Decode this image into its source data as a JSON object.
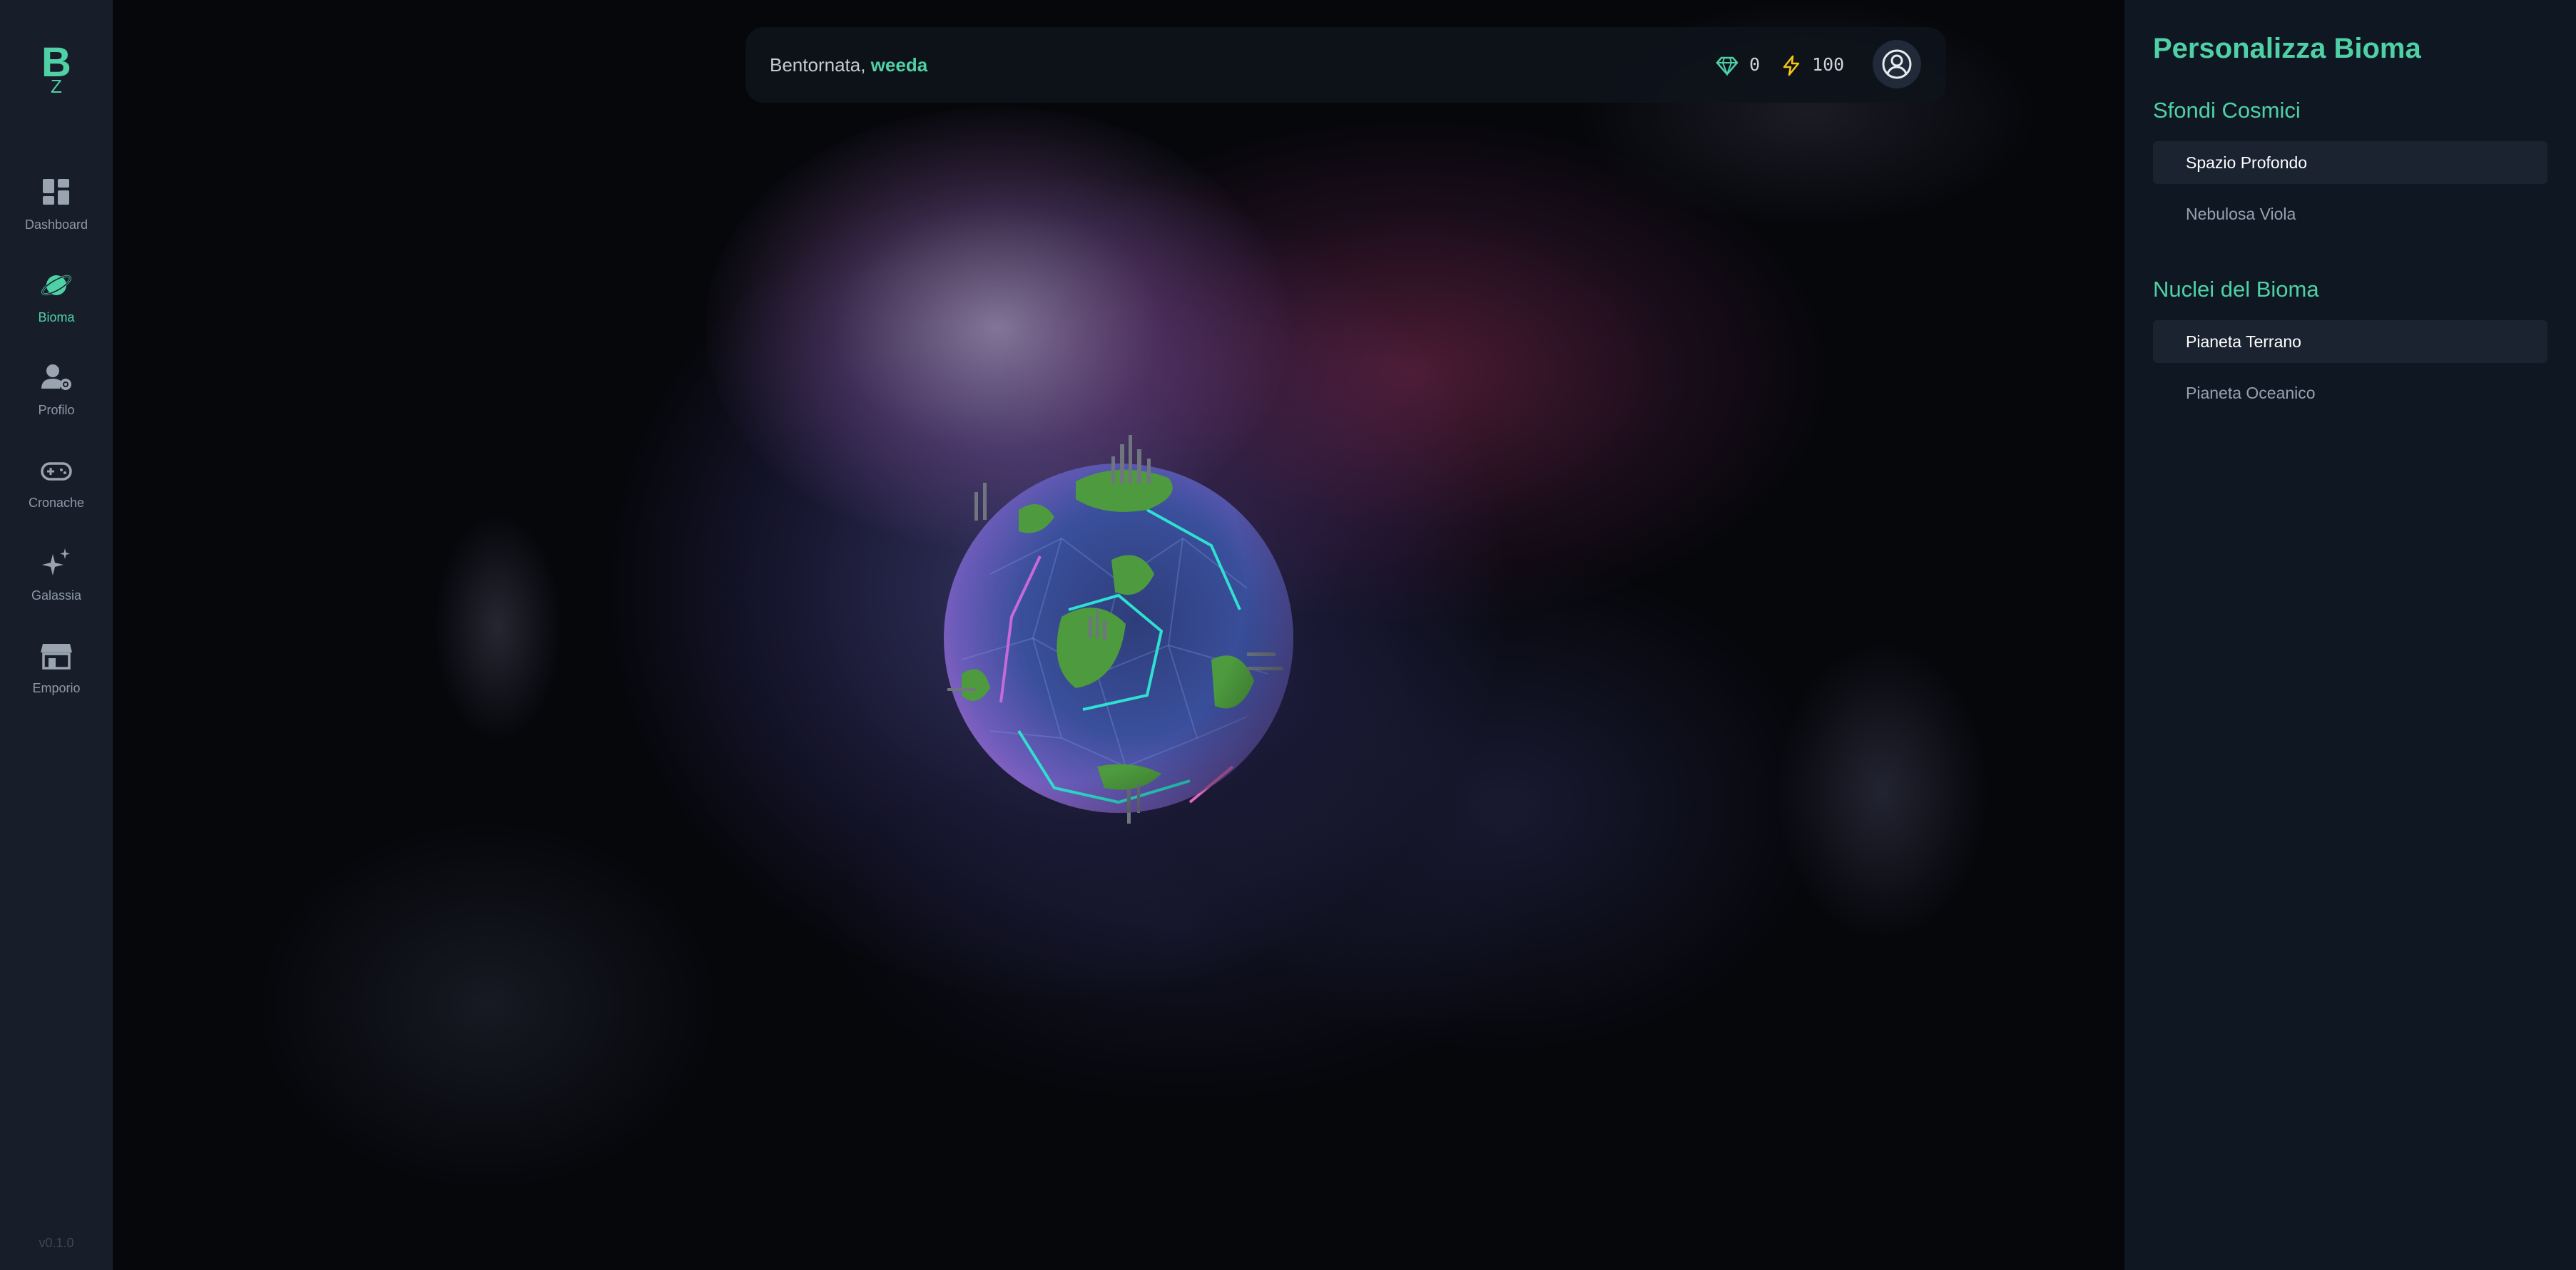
{
  "app": {
    "logo_letter": "B",
    "logo_sub": "Z",
    "version": "v0.1.0"
  },
  "sidebar": {
    "items": [
      {
        "label": "Dashboard",
        "icon": "dashboard-icon",
        "active": false
      },
      {
        "label": "Bioma",
        "icon": "planet-icon",
        "active": true
      },
      {
        "label": "Profilo",
        "icon": "user-settings-icon",
        "active": false
      },
      {
        "label": "Cronache",
        "icon": "gamepad-icon",
        "active": false
      },
      {
        "label": "Galassia",
        "icon": "sparkles-icon",
        "active": false
      },
      {
        "label": "Emporio",
        "icon": "store-icon",
        "active": false
      }
    ]
  },
  "header": {
    "greeting": "Bentornata,",
    "username": "weeda",
    "gems": "0",
    "energy": "100",
    "gem_icon": "gem-icon",
    "energy_icon": "lightning-icon",
    "profile_icon": "user-circle-icon"
  },
  "panel": {
    "title": "Personalizza Bioma",
    "sections": [
      {
        "title": "Sfondi Cosmici",
        "options": [
          {
            "label": "Spazio Profondo",
            "selected": true
          },
          {
            "label": "Nebulosa Viola",
            "selected": false
          }
        ]
      },
      {
        "title": "Nuclei del Bioma",
        "options": [
          {
            "label": "Pianeta Terrano",
            "selected": true
          },
          {
            "label": "Pianeta Oceanico",
            "selected": false
          }
        ]
      }
    ]
  },
  "colors": {
    "accent": "#4fd1a5",
    "sidebar_bg": "#171e2a",
    "panel_bg": "#0f1723",
    "energy": "#f5c518"
  }
}
